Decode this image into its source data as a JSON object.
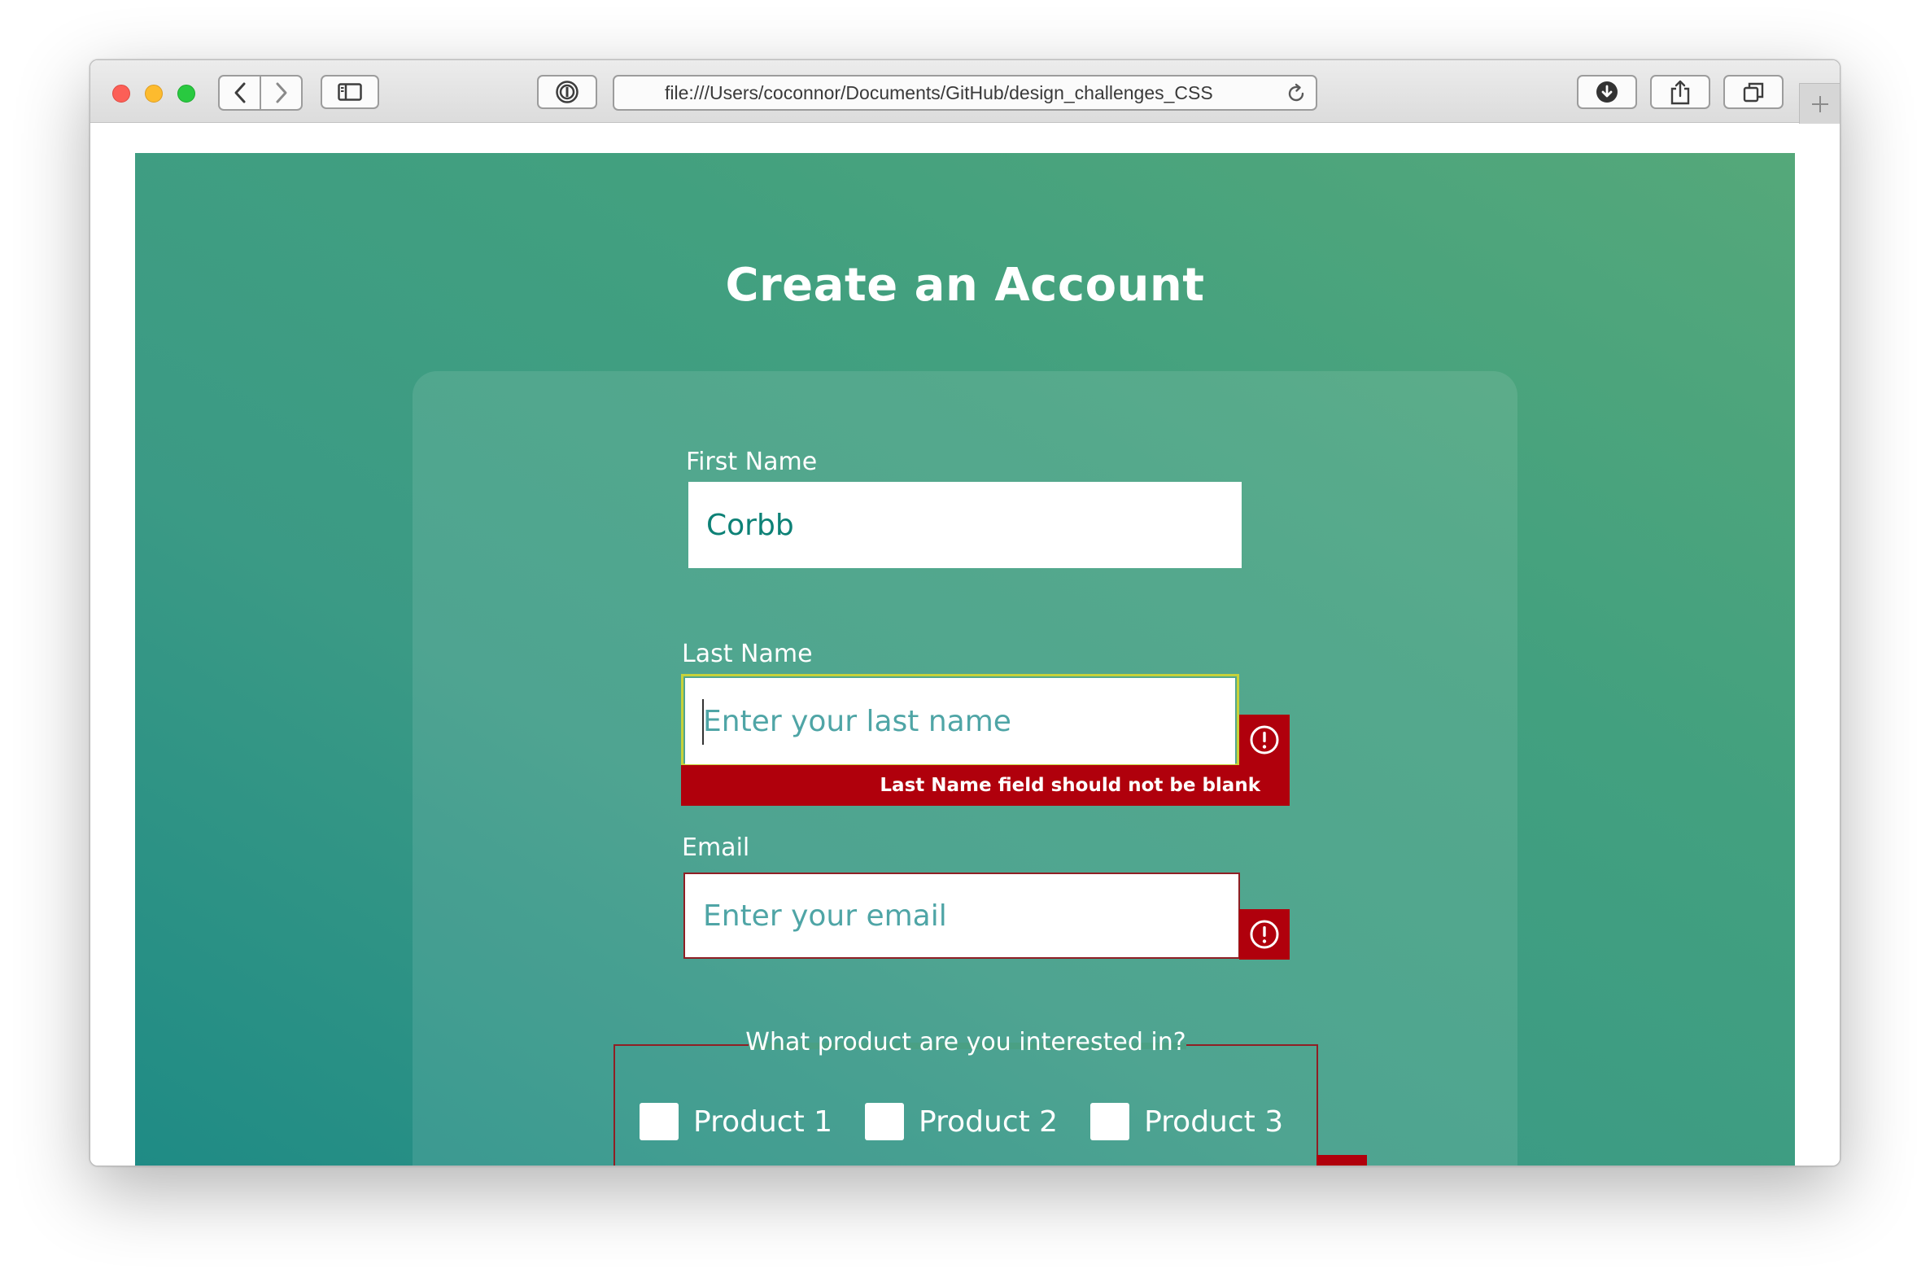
{
  "browser": {
    "url": "file:///Users/coconnor/Documents/GitHub/design_challenges_CSS",
    "icons": {
      "back": "chevron-left-icon",
      "forward": "chevron-right-icon",
      "sidebar": "sidebar-icon",
      "password": "password-manager-icon",
      "reload": "reload-icon",
      "download": "download-icon",
      "share": "share-icon",
      "tabs": "tabs-overview-icon",
      "new_tab": "plus-icon"
    }
  },
  "page": {
    "title": "Create an Account",
    "first_name": {
      "label": "First Name",
      "value": "Corbb"
    },
    "last_name": {
      "label": "Last Name",
      "placeholder": "Enter your last name",
      "error": "Last Name field should not be blank"
    },
    "email": {
      "label": "Email",
      "placeholder": "Enter your email"
    },
    "products": {
      "legend": "What product are you interested in?",
      "options": [
        "Product 1",
        "Product 2",
        "Product 3"
      ]
    }
  },
  "colors": {
    "gradient_start": "#1f8b85",
    "gradient_end": "#55a87a",
    "error": "#b0000c",
    "focus": "#c7d23a",
    "input_text": "#0d8176",
    "placeholder": "#4fa5a6"
  }
}
